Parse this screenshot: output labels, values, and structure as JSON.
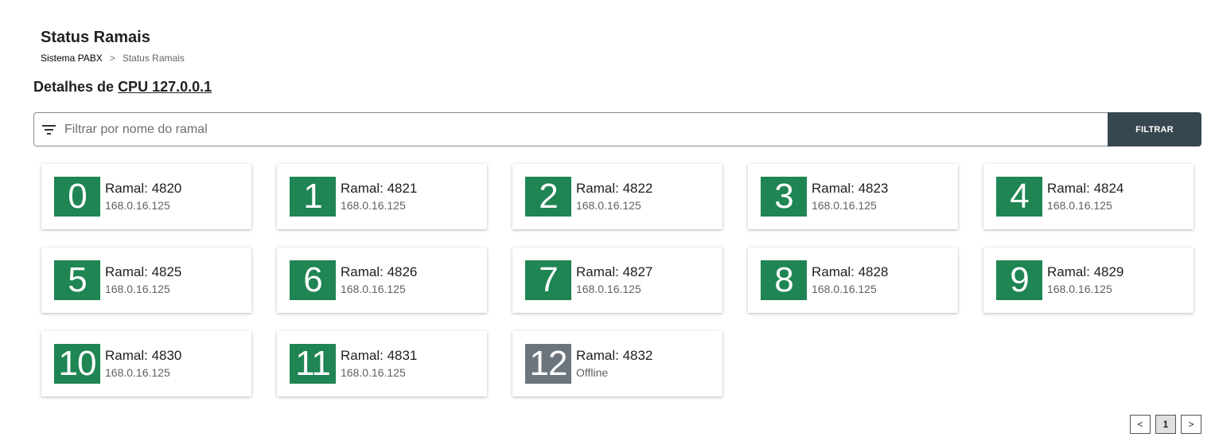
{
  "header": {
    "title": "Status Ramais",
    "breadcrumb": {
      "root": "Sistema PABX",
      "separator": ">",
      "current": "Status Ramais"
    }
  },
  "details": {
    "prefix": "Detalhes de",
    "cpu_link": "CPU 127.0.0.1"
  },
  "filter": {
    "icon": "filter-list-icon",
    "placeholder": "Filtrar por nome do ramal",
    "value": "",
    "button_label": "FILTRAR"
  },
  "colors": {
    "online": "#1e8553",
    "offline": "#6c747c",
    "filter_button": "#37474f"
  },
  "extensions": [
    {
      "index": "0",
      "title": "Ramal: 4820",
      "subtitle": "168.0.16.125",
      "status": "online"
    },
    {
      "index": "1",
      "title": "Ramal: 4821",
      "subtitle": "168.0.16.125",
      "status": "online"
    },
    {
      "index": "2",
      "title": "Ramal: 4822",
      "subtitle": "168.0.16.125",
      "status": "online"
    },
    {
      "index": "3",
      "title": "Ramal: 4823",
      "subtitle": "168.0.16.125",
      "status": "online"
    },
    {
      "index": "4",
      "title": "Ramal: 4824",
      "subtitle": "168.0.16.125",
      "status": "online"
    },
    {
      "index": "5",
      "title": "Ramal: 4825",
      "subtitle": "168.0.16.125",
      "status": "online"
    },
    {
      "index": "6",
      "title": "Ramal: 4826",
      "subtitle": "168.0.16.125",
      "status": "online"
    },
    {
      "index": "7",
      "title": "Ramal: 4827",
      "subtitle": "168.0.16.125",
      "status": "online"
    },
    {
      "index": "8",
      "title": "Ramal: 4828",
      "subtitle": "168.0.16.125",
      "status": "online"
    },
    {
      "index": "9",
      "title": "Ramal: 4829",
      "subtitle": "168.0.16.125",
      "status": "online"
    },
    {
      "index": "10",
      "title": "Ramal: 4830",
      "subtitle": "168.0.16.125",
      "status": "online"
    },
    {
      "index": "11",
      "title": "Ramal: 4831",
      "subtitle": "168.0.16.125",
      "status": "online"
    },
    {
      "index": "12",
      "title": "Ramal: 4832",
      "subtitle": "Offline",
      "status": "offline"
    }
  ],
  "pagination": {
    "prev_label": "<",
    "current_page": "1",
    "next_label": ">"
  }
}
